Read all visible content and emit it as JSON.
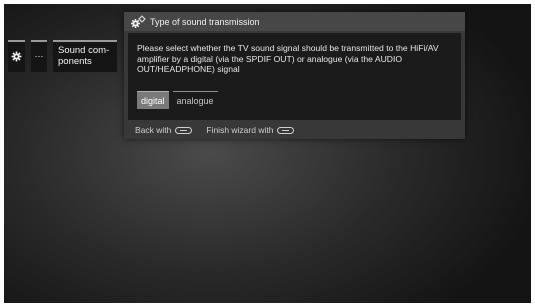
{
  "menu": {
    "settings_icon": "gear-icon",
    "more_label": "···",
    "sound_components_line1": "Sound com-",
    "sound_components_line2": "ponents"
  },
  "dialog": {
    "icon": "gears-icon",
    "title": "Type of sound transmission",
    "message": "Please select whether the TV sound signal should be transmitted to the HiFi/AV amplifier by a digital (via the SPDIF OUT) or analogue (via the AUDIO OUT/HEADPHONE) signal",
    "options": [
      "digital",
      "analogue"
    ],
    "selected_option": "digital",
    "footer": {
      "back_label": "Back with",
      "back_icon": "back-button-icon",
      "finish_label": "Finish wizard with",
      "finish_icon": "end-button-icon"
    }
  },
  "colors": {
    "dialog_bg": "#383838",
    "header_bg": "#474747",
    "body_bg": "#1b1b1b",
    "selected_option_bg": "#7a7a7a",
    "tile_bg": "#151515"
  }
}
